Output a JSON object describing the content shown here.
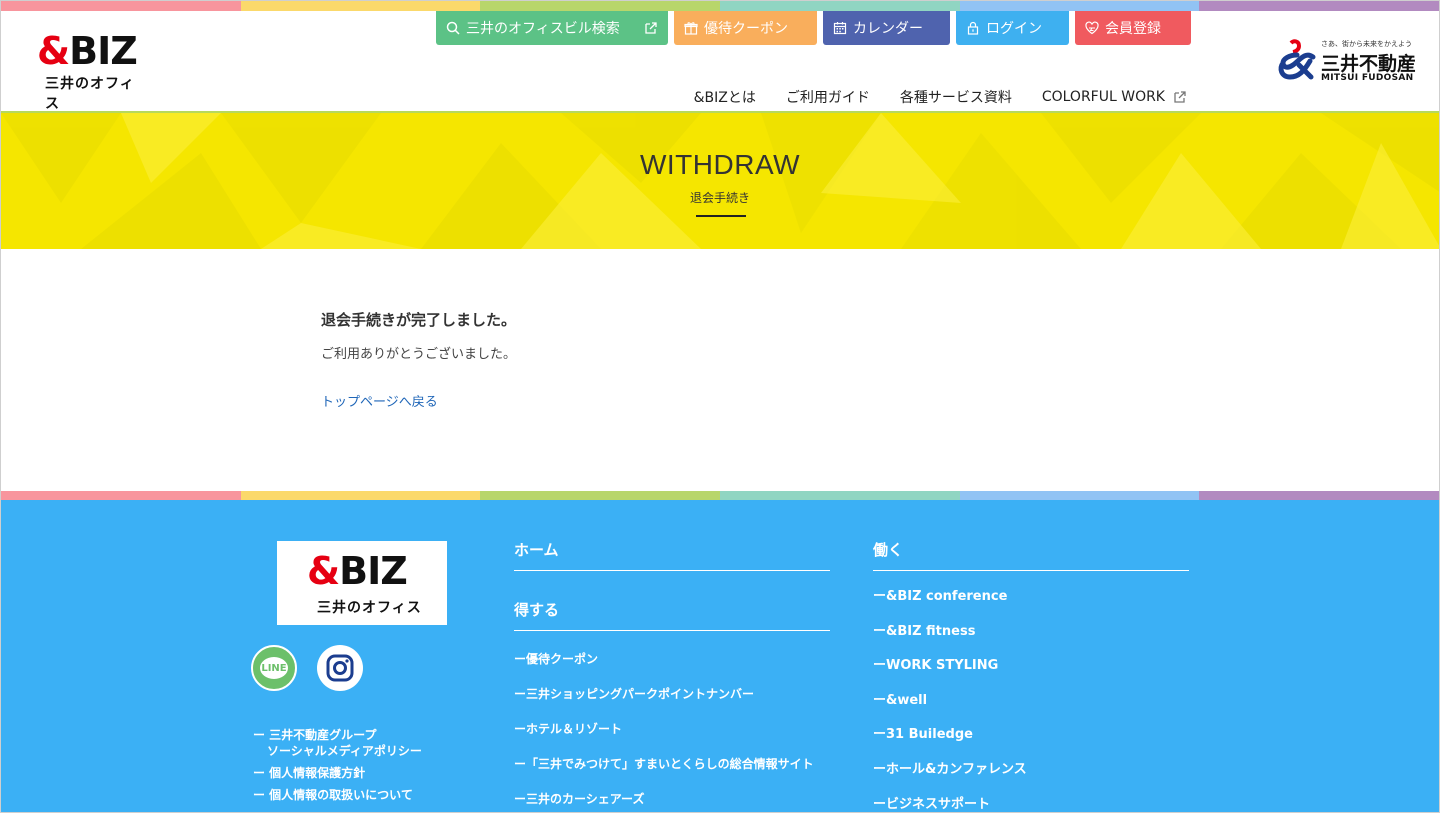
{
  "colors": {
    "rainbow": [
      "#f8959d",
      "#fbd96b",
      "#b8d66b",
      "#90d5c2",
      "#91c3f4",
      "#b28ac0"
    ],
    "btn_search": "#5cc286",
    "btn_coupon": "#f9ae5c",
    "btn_calendar": "#4f63ae",
    "btn_login": "#3eb0f0",
    "btn_register": "#f05a5f",
    "hero_yellow": "#f5e600",
    "footer_blue": "#3bb0f5",
    "link_blue": "#1f66b8"
  },
  "logo": {
    "main": "&BIZ",
    "sub": "三井のオフィス"
  },
  "top_buttons": [
    {
      "label": "三井のオフィスビル検索",
      "icon": "search-icon"
    },
    {
      "label": "優待クーポン",
      "icon": "gift-icon"
    },
    {
      "label": "カレンダー",
      "icon": "calendar-icon"
    },
    {
      "label": "ログイン",
      "icon": "lock-icon"
    },
    {
      "label": "会員登録",
      "icon": "heart-icon"
    }
  ],
  "nav": [
    {
      "label": "&BIZとは"
    },
    {
      "label": "ご利用ガイド"
    },
    {
      "label": "各種サービス資料"
    },
    {
      "label": "COLORFUL WORK"
    }
  ],
  "mitsui": {
    "tagline": "さあ、街から未来をかえよう",
    "jp": "三井不動産",
    "en": "MITSUI FUDOSAN"
  },
  "hero": {
    "title": "WITHDRAW",
    "subtitle": "退会手続き"
  },
  "content": {
    "title": "退会手続きが完了しました。",
    "body": "ご利用ありがとうございました。",
    "back_link": "トップページへ戻る"
  },
  "footer": {
    "logo_main": "&BIZ",
    "logo_sub": "三井のオフィス",
    "line_label": "LINE",
    "left_links": [
      {
        "lines": [
          "ー 三井不動産グループ",
          "ソーシャルメディアポリシー"
        ]
      },
      {
        "lines": [
          "ー 個人情報保護方針"
        ]
      },
      {
        "lines": [
          "ー 個人情報の取扱いについて"
        ]
      }
    ],
    "col1": {
      "head1": "ホーム",
      "head2": "得する",
      "items": [
        "ー優待クーポン",
        "ー三井ショッピングパークポイントナンバー",
        "ーホテル＆リゾート",
        "ー「三井でみつけて」すまいとくらしの総合情報サイト",
        "ー三井のカーシェアーズ"
      ]
    },
    "col2": {
      "head": "働く",
      "items": [
        "ー&BIZ conference",
        "ー&BIZ fitness",
        "ーWORK STYLING",
        "ー&well",
        "ー31 Builedge",
        "ーホール&カンファレンス",
        "ービジネスサポート"
      ]
    }
  }
}
